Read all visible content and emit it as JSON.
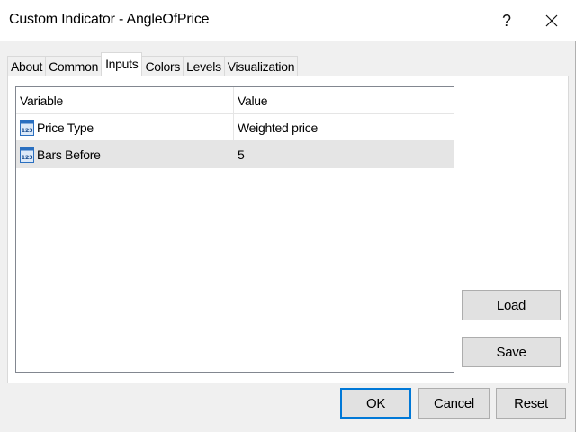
{
  "window": {
    "title": "Custom Indicator - AngleOfPrice",
    "help_label": "?"
  },
  "tabs": [
    {
      "label": "About"
    },
    {
      "label": "Common"
    },
    {
      "label": "Inputs"
    },
    {
      "label": "Colors"
    },
    {
      "label": "Levels"
    },
    {
      "label": "Visualization"
    }
  ],
  "active_tab": "Inputs",
  "grid": {
    "headers": {
      "variable": "Variable",
      "value": "Value"
    },
    "rows": [
      {
        "variable": "Price Type",
        "value": "Weighted price",
        "icon": "numeric-123-icon"
      },
      {
        "variable": "Bars Before",
        "value": "5",
        "icon": "numeric-123-icon"
      }
    ]
  },
  "side_buttons": {
    "load": "Load",
    "save": "Save"
  },
  "footer_buttons": {
    "ok": "OK",
    "cancel": "Cancel",
    "reset": "Reset"
  },
  "colors": {
    "accent": "#0078d7",
    "button_face": "#e1e1e1",
    "selection": "#e5e5e5",
    "icon_blue": "#2a6fc0"
  }
}
